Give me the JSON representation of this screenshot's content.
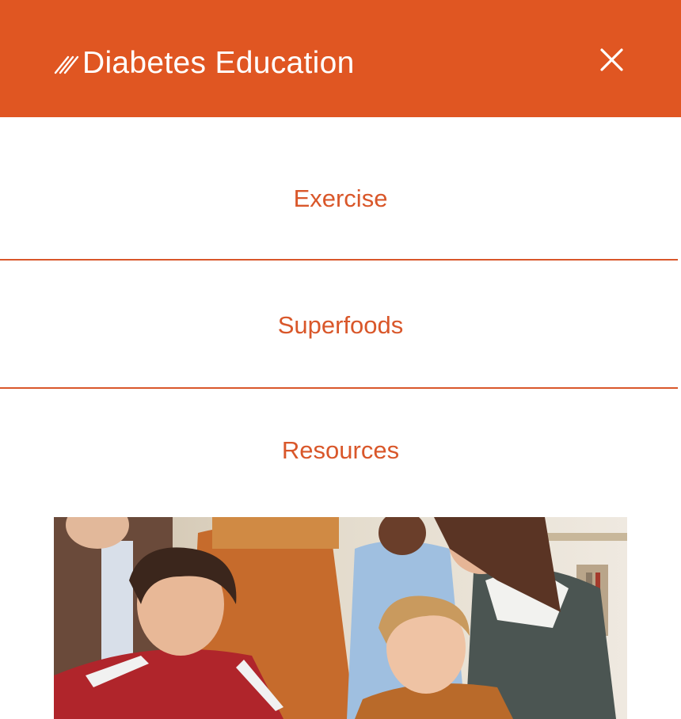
{
  "header": {
    "title": "Diabetes Education",
    "logo_icon": "triple-slash-logo-icon",
    "close_icon": "close-icon",
    "background_color": "#e05622",
    "text_color": "#ffffff"
  },
  "nav": {
    "accent_color": "#d9572a",
    "items": [
      {
        "label": "Exercise"
      },
      {
        "label": "Superfoods"
      },
      {
        "label": "Resources"
      }
    ]
  },
  "image": {
    "subject": "students-reading-together-photo"
  }
}
